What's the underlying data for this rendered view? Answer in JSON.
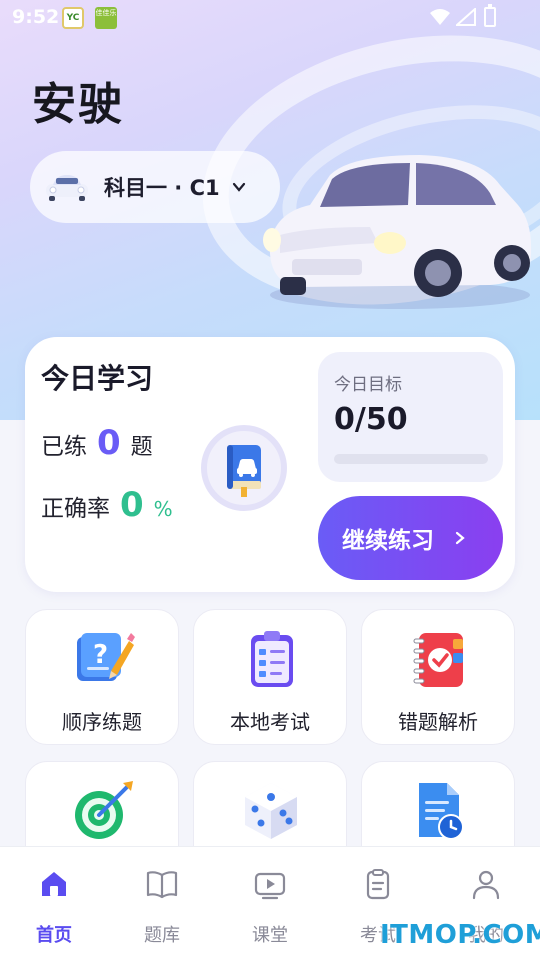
{
  "status_bar": {
    "time": "9:52",
    "notif1": "YC",
    "notif2": "佳佳乐"
  },
  "header": {
    "app_title": "安驶",
    "subject": "科目一 · C1"
  },
  "today": {
    "title": "今日学习",
    "done_label": "已练",
    "done_value": "0",
    "done_unit": "题",
    "accuracy_label": "正确率",
    "accuracy_value": "0",
    "accuracy_unit": "%",
    "goal_label": "今日目标",
    "goal_value": "0/50",
    "goal_progress": 0,
    "continue_label": "继续练习"
  },
  "grid": {
    "tiles": [
      {
        "label": "顺序练题",
        "icon": "pencil-quiz-icon"
      },
      {
        "label": "本地考试",
        "icon": "clipboard-checklist-icon"
      },
      {
        "label": "错题解析",
        "icon": "red-notebook-icon"
      },
      {
        "label": "",
        "icon": "target-arrow-icon"
      },
      {
        "label": "",
        "icon": "dice-icon"
      },
      {
        "label": "",
        "icon": "document-clock-icon"
      }
    ]
  },
  "bottom_nav": {
    "items": [
      {
        "label": "首页",
        "icon": "home-icon",
        "active": true
      },
      {
        "label": "题库",
        "icon": "book-icon",
        "active": false
      },
      {
        "label": "课堂",
        "icon": "video-icon",
        "active": false
      },
      {
        "label": "考试",
        "icon": "exam-clipboard-icon",
        "active": false
      },
      {
        "label": "我的",
        "icon": "user-icon",
        "active": false
      }
    ]
  },
  "watermark": "ITMOP.COM",
  "colors": {
    "accent": "#6a5cf6",
    "accent2": "#8a3ff0",
    "success": "#2fbf8f"
  }
}
